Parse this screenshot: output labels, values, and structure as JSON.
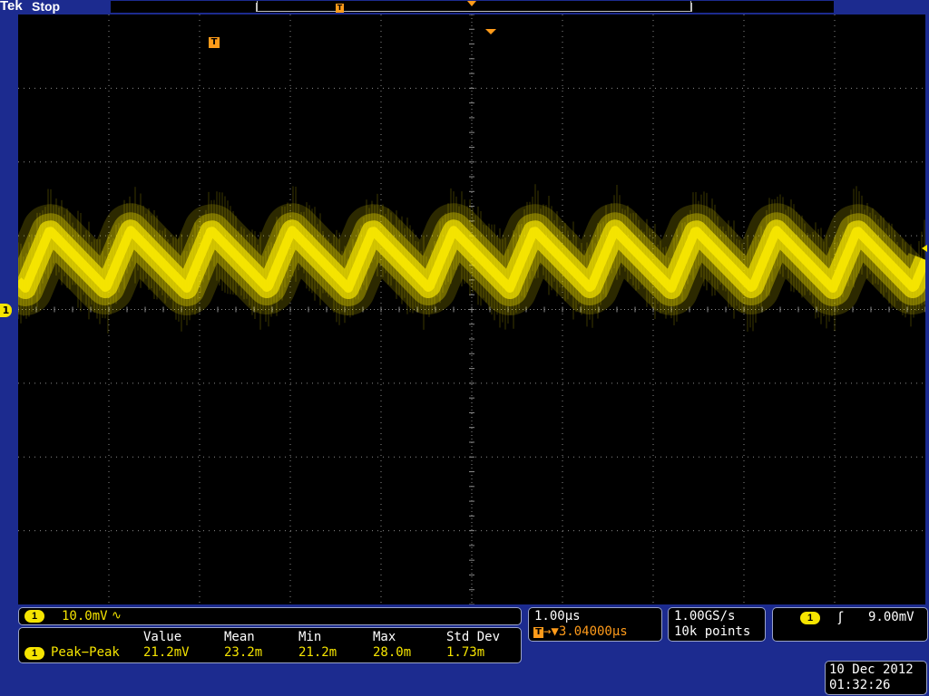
{
  "header": {
    "brand": "Tek",
    "status": "Stop",
    "record_trigger_label": "T"
  },
  "screen": {
    "trigger_marker": "T",
    "channel_marker": "1"
  },
  "channel": {
    "badge": "1",
    "scale": "10.0mV",
    "coupling_symbol": "∿"
  },
  "measurements": {
    "headers": [
      "Value",
      "Mean",
      "Min",
      "Max",
      "Std Dev"
    ],
    "rows": [
      {
        "badge": "1",
        "name": "Peak−Peak",
        "values": [
          "21.2mV",
          "23.2m",
          "21.2m",
          "28.0m",
          "1.73m"
        ]
      }
    ]
  },
  "timebase": {
    "scale": "1.00µs",
    "trigger_icon": "T",
    "delay": "→▼3.04000µs"
  },
  "acquisition": {
    "sample_rate": "1.00GS/s",
    "record_length": "10k points"
  },
  "trigger": {
    "badge": "1",
    "slope_symbol": "ʃ",
    "level": "9.00mV"
  },
  "clock": {
    "date": "10 Dec 2012",
    "time": "01:32:26"
  },
  "colors": {
    "trace": "#f5e400",
    "trigger": "#ff9b1a",
    "background": "#000000",
    "bezel": "#1c2b8f"
  }
}
